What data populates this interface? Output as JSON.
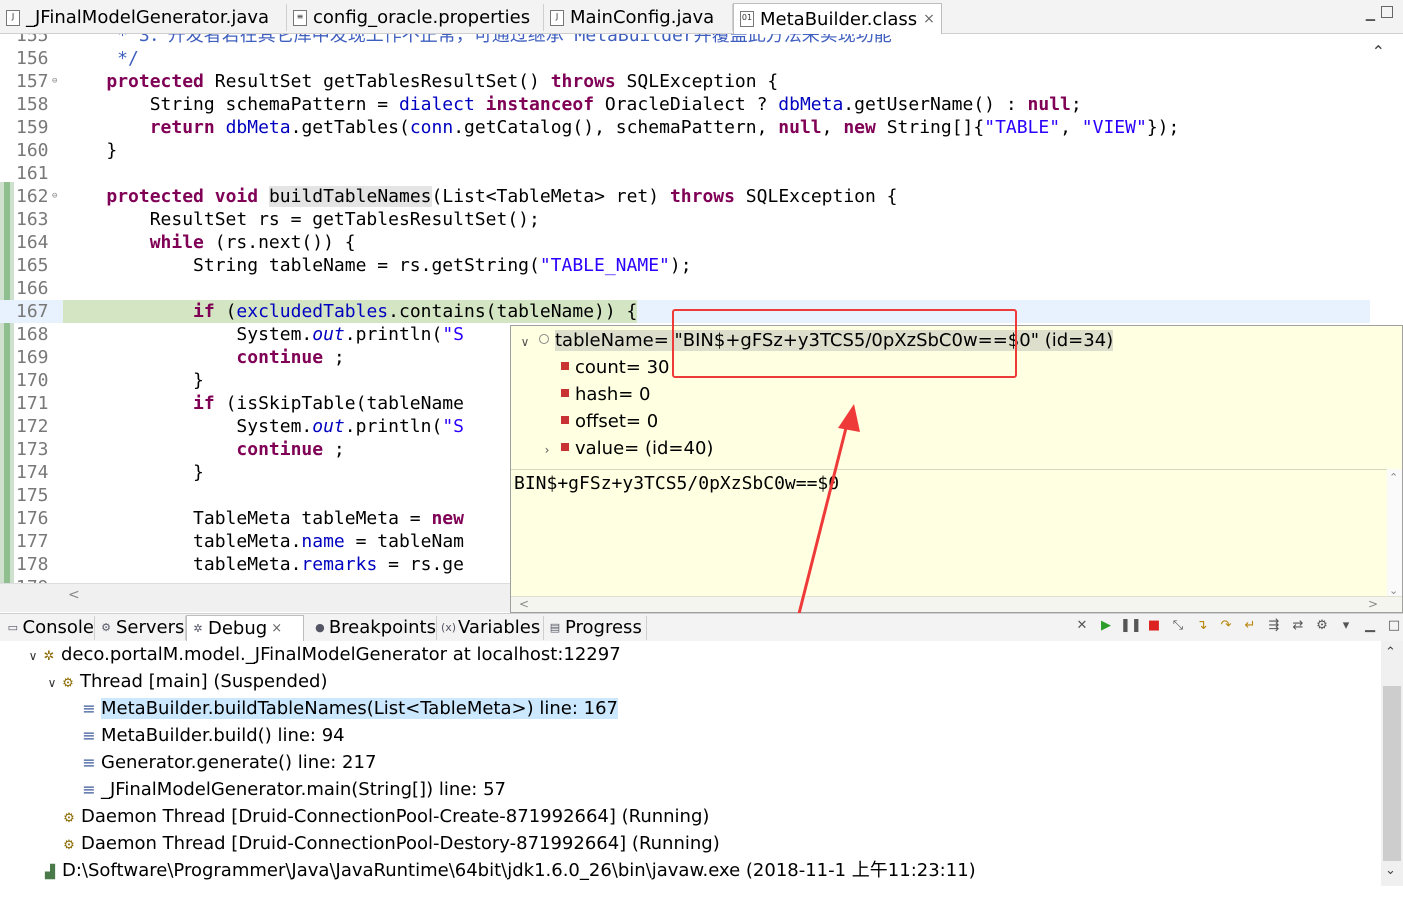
{
  "editor_tabs": [
    {
      "label": "_JFinalModelGenerator.java",
      "icon": "java-file-icon"
    },
    {
      "label": "config_oracle.properties",
      "icon": "properties-file-icon"
    },
    {
      "label": "MainConfig.java",
      "icon": "java-file-icon"
    },
    {
      "label": "MetaBuilder.class",
      "icon": "class-file-icon",
      "active": true,
      "close": "×"
    }
  ],
  "code_lines": [
    {
      "n": "155",
      "html": "<span class='cm'>     * 3：开发者若在其它库中发现工作不正常，可通过继承 MetaBuilder并覆盖此方法来实现功能</span>"
    },
    {
      "n": "156",
      "html": "<span class='cm'>     */</span>"
    },
    {
      "n": "157",
      "mark": "⊖",
      "html": "    <span class='kw'>protected</span> ResultSet getTablesResultSet() <span class='kw'>throws</span> SQLException {"
    },
    {
      "n": "158",
      "html": "        String schemaPattern = <span class='fd'>dialect</span> <span class='kw'>instanceof</span> OracleDialect ? <span class='fd'>dbMeta</span>.getUserName() : <span class='kw'>null</span>;"
    },
    {
      "n": "159",
      "html": "        <span class='kw'>return</span> <span class='fd'>dbMeta</span>.getTables(<span class='fd'>conn</span>.getCatalog(), schemaPattern, <span class='kw'>null</span>, <span class='kw'>new</span> String[]{<span class='st'>\"TABLE\"</span>, <span class='st'>\"VIEW\"</span>});"
    },
    {
      "n": "160",
      "html": "    }"
    },
    {
      "n": "161",
      "html": ""
    },
    {
      "n": "162",
      "mark": "⊖",
      "html": "    <span class='kw'>protected</span> <span class='kw'>void</span> <span style='background:#e4e4e4'>buildTableNames</span>(List&lt;TableMeta&gt; ret) <span class='kw'>throws</span> SQLException {"
    },
    {
      "n": "163",
      "html": "        ResultSet rs = getTablesResultSet();"
    },
    {
      "n": "164",
      "html": "        <span class='kw'>while</span> (rs.next()) {"
    },
    {
      "n": "165",
      "html": "            String tableName = rs.getString(<span class='st'>\"TABLE_NAME\"</span>);"
    },
    {
      "n": "166",
      "html": ""
    },
    {
      "n": "167",
      "current": true,
      "html": "            <span class='kw'>if</span> (<span class='fd'>excludedTables</span>.contains(tableName)) {"
    },
    {
      "n": "168",
      "html": "                System.<span class='it'>out</span>.println(<span class='st'>\"S</span>"
    },
    {
      "n": "169",
      "html": "                <span class='kw'>continue</span> ;"
    },
    {
      "n": "170",
      "html": "            }"
    },
    {
      "n": "171",
      "html": "            <span class='kw'>if</span> (isSkipTable(tableName"
    },
    {
      "n": "172",
      "html": "                System.<span class='it'>out</span>.println(<span class='st'>\"S</span>"
    },
    {
      "n": "173",
      "html": "                <span class='kw'>continue</span> ;"
    },
    {
      "n": "174",
      "html": "            }"
    },
    {
      "n": "175",
      "html": ""
    },
    {
      "n": "176",
      "html": "            TableMeta tableMeta = <span class='kw'>new</span>"
    },
    {
      "n": "177",
      "html": "            tableMeta.<span class='fd'>name</span> = tableNam"
    },
    {
      "n": "178",
      "html": "            tableMeta.<span class='fd'>remarks</span> = rs.ge"
    },
    {
      "n": "179",
      "html": ""
    }
  ],
  "hover": {
    "root_name": "tableName= ",
    "root_value": "\"BIN$+gFSz+y3TCS5/0pXzSbC0w==$0\"",
    "root_id": " (id=34)",
    "fields": [
      {
        "label": "count= 30",
        "expandable": false
      },
      {
        "label": "hash= 0",
        "expandable": false
      },
      {
        "label": "offset= 0",
        "expandable": false
      },
      {
        "label": "value=  (id=40)",
        "expandable": true
      }
    ],
    "detail_text": "BIN$+gFSz+y3TCS5/0pXzSbC0w==$0"
  },
  "view_tabs": [
    {
      "label": "Console",
      "icon": "console-icon"
    },
    {
      "label": "Servers",
      "icon": "servers-icon"
    },
    {
      "label": "Debug",
      "icon": "debug-icon",
      "active": true,
      "close": "×"
    },
    {
      "label": "Breakpoints",
      "icon": "breakpoints-icon"
    },
    {
      "label": "Variables",
      "icon": "variables-icon"
    },
    {
      "label": "Progress",
      "icon": "progress-icon"
    }
  ],
  "debug_tree": {
    "launch": "deco.portalM.model._JFinalModelGenerator at localhost:12297",
    "thread": "Thread [main] (Suspended)",
    "frames": [
      "MetaBuilder.buildTableNames(List<TableMeta>) line: 167",
      "MetaBuilder.build() line: 94",
      "Generator.generate() line: 217",
      "_JFinalModelGenerator.main(String[]) line: 57"
    ],
    "daemons": [
      "Daemon Thread [Druid-ConnectionPool-Create-871992664] (Running)",
      "Daemon Thread [Druid-ConnectionPool-Destory-871992664] (Running)"
    ],
    "process": "D:\\Software\\Programmer\\Java\\JavaRuntime\\64bit\\jdk1.6.0_26\\bin\\javaw.exe (2018-11-1 上午11:23:11)"
  }
}
